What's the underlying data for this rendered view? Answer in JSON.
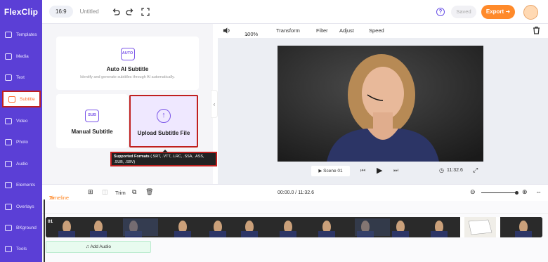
{
  "app": {
    "logo_text": "FlexClip"
  },
  "topbar": {
    "ratio": "16:9",
    "title": "Untitled",
    "saved_label": "Saved",
    "export_label": "Export",
    "help_label": "?"
  },
  "sidebar": {
    "items": [
      {
        "label": "Templates"
      },
      {
        "label": "Media"
      },
      {
        "label": "Text"
      },
      {
        "label": "Subtitle"
      },
      {
        "label": "Video"
      },
      {
        "label": "Photo"
      },
      {
        "label": "Audio"
      },
      {
        "label": "Elements"
      },
      {
        "label": "Overlays"
      },
      {
        "label": "BKground"
      },
      {
        "label": "Tools"
      }
    ],
    "active": "Subtitle"
  },
  "subtitle_panel": {
    "auto": {
      "badge": "AUTO",
      "title": "Auto AI Subtitle",
      "desc": "Identify and generate subtitles through AI automatically."
    },
    "manual": {
      "badge": "SUB",
      "title": "Manual Subtitle"
    },
    "upload": {
      "title": "Upload Subtitle File"
    },
    "tooltip_title": "Supported Formats",
    "tooltip_formats": "(.SRT, .VTT, .LRC, .SSA, .ASS, .SUB, .SBV)"
  },
  "editor_toolbar": {
    "zoom": "100%",
    "transform": "Transform",
    "filter": "Filter",
    "adjust": "Adjust",
    "speed": "Speed"
  },
  "player": {
    "scene": "Scene 01",
    "duration": "11:32.6"
  },
  "timeline": {
    "label": "Timeline",
    "trim": "Trim",
    "time": "00:00.0 / 11:32.6",
    "track_number": "01",
    "add_audio": "Add Audio"
  },
  "colors": {
    "brand_purple": "#5b3fd6",
    "accent_orange": "#ff8a2a",
    "highlight_red": "#c0201f"
  }
}
